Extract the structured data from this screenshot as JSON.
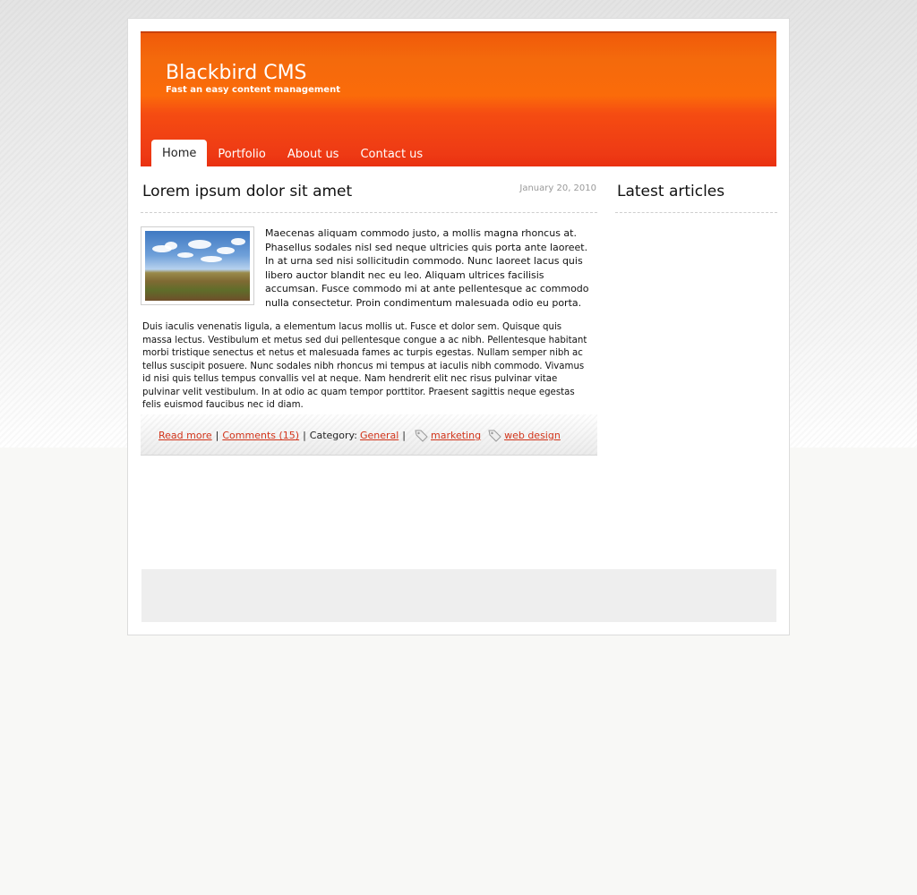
{
  "site": {
    "title": "Blackbird CMS",
    "tagline": "Fast an easy content management"
  },
  "nav": {
    "items": [
      {
        "label": "Home",
        "active": true
      },
      {
        "label": "Portfolio",
        "active": false
      },
      {
        "label": "About us",
        "active": false
      },
      {
        "label": "Contact us",
        "active": false
      }
    ]
  },
  "post": {
    "title": "Lorem ipsum dolor sit amet",
    "date": "January 20, 2010",
    "intro": "Maecenas aliquam commodo justo, a mollis magna rhoncus at. Phasellus sodales nisl sed neque ultricies quis porta ante laoreet. In at urna sed nisi sollicitudin commodo. Nunc laoreet lacus quis libero auctor blandit nec eu leo. Aliquam ultrices facilisis accumsan. Fusce commodo mi at ante pellentesque ac commodo nulla consectetur. Proin condimentum malesuada odio eu porta.",
    "body": "Duis iaculis venenatis ligula, a elementum lacus mollis ut. Fusce et dolor sem. Quisque quis massa lectus. Vestibulum et metus sed dui pellentesque congue a ac nibh. Pellentesque habitant morbi tristique senectus et netus et malesuada fames ac turpis egestas. Nullam semper nibh ac tellus suscipit posuere. Nunc sodales nibh rhoncus mi tempus at iaculis nibh commodo. Vivamus id nisi quis tellus tempus convallis vel at neque. Nam hendrerit elit nec risus pulvinar vitae pulvinar velit vestibulum. In at odio ac quam tempor porttitor. Praesent sagittis neque egestas felis euismod faucibus nec id diam.",
    "footer": {
      "read_more": "Read more",
      "comments": "Comments (15)",
      "category_label": "Category:",
      "category": "General",
      "tags": [
        "marketing",
        "web design"
      ]
    }
  },
  "sidebar": {
    "title": "Latest articles"
  },
  "colors": {
    "accent": "#d2341a",
    "header_orange": "#fb6b0a",
    "header_red": "#e82f10"
  }
}
